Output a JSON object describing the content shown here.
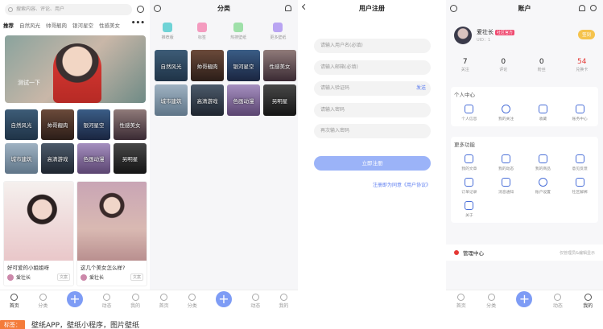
{
  "home": {
    "search_placeholder": "搜索内容、评论、用户",
    "categories": [
      "推荐",
      "自然风光",
      "帅哥靓肉",
      "银河星空",
      "性感美女"
    ],
    "more": "•••",
    "banner_text": "测试一下",
    "tiles": [
      "自然风光",
      "帅哥靓肉",
      "银河星空",
      "性感美女",
      "城市建筑",
      "高清游戏",
      "色画动漫",
      "另明星"
    ],
    "posts": [
      {
        "title": "好可爱的小姐姐呀",
        "user": "爱壮长",
        "badge": "文案"
      },
      {
        "title": "这几个美女怎么样?",
        "user": "爱壮长",
        "badge": "文案"
      }
    ]
  },
  "tabs": {
    "home": "首页",
    "category": "分类",
    "plus": "+",
    "feed": "动态",
    "mine": "我的"
  },
  "category_page": {
    "title": "分类",
    "quick": [
      "推荐版",
      "标签",
      "热搜壁纸",
      "更多壁纸"
    ],
    "tiles": [
      "自然风光",
      "帅哥靓肉",
      "银河星空",
      "性感美女",
      "城市建筑",
      "高清游戏",
      "色画动漫",
      "另明星"
    ]
  },
  "register": {
    "title": "用户注册",
    "username": "请输入用户名(必填)",
    "email": "请输入邮箱(必填)",
    "code": "请输入验证码",
    "send": "发送",
    "password": "请输入密码",
    "password2": "再次输入密码",
    "submit": "立即注册",
    "agreement": "注册即为同意《用户协议》"
  },
  "account": {
    "title": "账户",
    "name": "爱壮长",
    "badge": "社区官方",
    "uid": "UID：1",
    "sign": "签到",
    "stats": [
      {
        "n": "7",
        "l": "关注"
      },
      {
        "n": "0",
        "l": "评论"
      },
      {
        "n": "0",
        "l": "粉丝"
      },
      {
        "n": "54",
        "l": "兑换卡"
      }
    ],
    "personal_title": "个人中心",
    "personal": [
      "个人信息",
      "我的关注",
      "收藏",
      "账务中心"
    ],
    "more_title": "更多功能",
    "more": [
      "我的文章",
      "我的动态",
      "我的商品",
      "意见反馈",
      "订单记录",
      "消息通知",
      "账户设置",
      "社区解绑",
      "关于"
    ],
    "manager": "管理中心",
    "manager_hint": "仅管理员&编辑显示"
  },
  "caption": {
    "tag": "标签：",
    "text": "壁纸APP，壁纸小程序，图片壁纸"
  }
}
